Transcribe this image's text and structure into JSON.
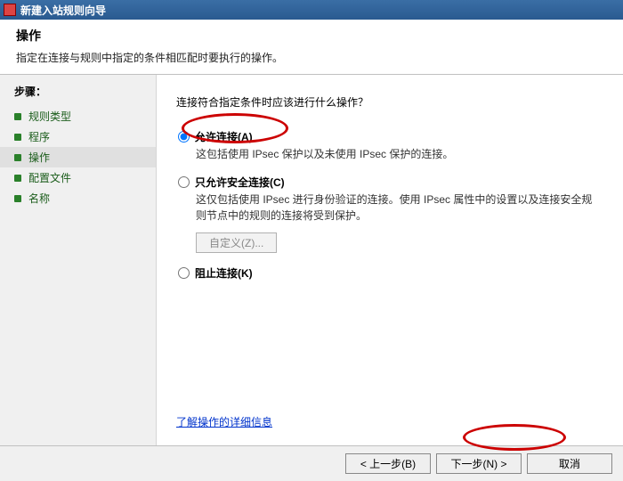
{
  "window": {
    "title": "新建入站规则向导"
  },
  "header": {
    "title": "操作",
    "subtitle": "指定在连接与规则中指定的条件相匹配时要执行的操作。"
  },
  "steps": {
    "title": "步骤：",
    "items": [
      {
        "label": "规则类型",
        "active": false
      },
      {
        "label": "程序",
        "active": false
      },
      {
        "label": "操作",
        "active": true
      },
      {
        "label": "配置文件",
        "active": false
      },
      {
        "label": "名称",
        "active": false
      }
    ]
  },
  "content": {
    "prompt": "连接符合指定条件时应该进行什么操作？",
    "options": [
      {
        "label": "允许连接(A)",
        "desc": "这包括使用 IPsec 保护以及未使用 IPsec 保护的连接。",
        "checked": true
      },
      {
        "label": "只允许安全连接(C)",
        "desc": "这仅包括使用 IPsec 进行身份验证的连接。使用 IPsec 属性中的设置以及连接安全规则节点中的规则的连接将受到保护。",
        "checked": false
      },
      {
        "label": "阻止连接(K)",
        "desc": "",
        "checked": false
      }
    ],
    "customize_btn": "自定义(Z)...",
    "learn_more": "了解操作的详细信息"
  },
  "footer": {
    "back": "< 上一步(B)",
    "next": "下一步(N) >",
    "cancel": "取消"
  }
}
